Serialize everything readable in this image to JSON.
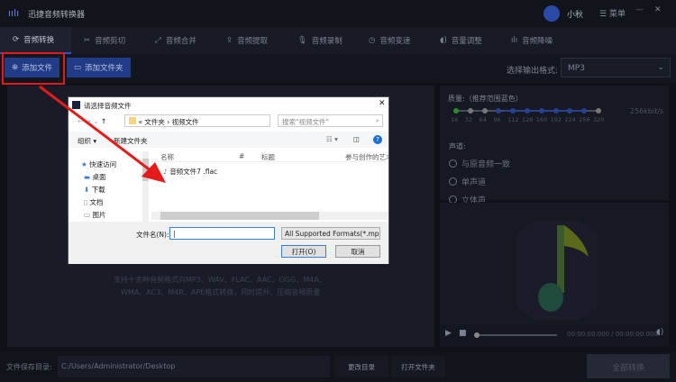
{
  "app": {
    "title": "迅捷音频转换器",
    "user": "小秋",
    "menu": "菜单"
  },
  "tabs": [
    {
      "label": "音频转换",
      "icon": "refresh-icon"
    },
    {
      "label": "音频剪切",
      "icon": "scissors-icon"
    },
    {
      "label": "音频合并",
      "icon": "merge-icon"
    },
    {
      "label": "音频提取",
      "icon": "extract-icon"
    },
    {
      "label": "音频录制",
      "icon": "mic-icon"
    },
    {
      "label": "音频变速",
      "icon": "speed-icon"
    },
    {
      "label": "音量调整",
      "icon": "volume-icon"
    },
    {
      "label": "音频降噪",
      "icon": "denoise-icon"
    }
  ],
  "toolbar": {
    "add_file": "添加文件",
    "add_folder": "添加文件夹",
    "format_label": "选择输出格式:",
    "format_value": "MP3"
  },
  "left": {
    "support_line1": "支持十余种音频格式向MP3、WAV、FLAC、AAC、OGG、M4A、",
    "support_line2": "WMA、AC3、M4R、APE格式转换，同时提升、压缩音频质量"
  },
  "settings": {
    "quality_label": "质量:（推荐范围蓝色）",
    "bitrates": [
      "16",
      "32",
      "64",
      "96",
      "112",
      "128",
      "160",
      "192",
      "224",
      "256",
      "320"
    ],
    "current_bitrate": "256kbit/s",
    "channel_label": "声道:",
    "channels": [
      "与原音频一致",
      "单声道",
      "立体声"
    ]
  },
  "player": {
    "time": "00:00:00.000 / 00:00:00.000",
    "progress": 0
  },
  "bottom": {
    "save_label": "文件保存目录:",
    "save_path": "C:/Users/Administrator/Desktop",
    "change_dir": "更改目录",
    "open_folder": "打开文件夹",
    "convert_all": "全部转换"
  },
  "dialog": {
    "title": "请选择音频文件",
    "crumb_root": "文件夹",
    "crumb_current": "视频文件",
    "search_placeholder": "搜索\"视频文件\"",
    "organize": "组织 ▾",
    "new_folder": "新建文件夹",
    "nav": [
      {
        "label": "快速访问"
      },
      {
        "label": "桌面"
      },
      {
        "label": "下载"
      },
      {
        "label": "文档"
      },
      {
        "label": "图片"
      }
    ],
    "columns": [
      "名称",
      "#",
      "标题",
      "参与创作的艺术"
    ],
    "files": [
      "音频文件7 .flac"
    ],
    "filename_label": "文件名(N):",
    "filename_value": "",
    "filter": "All Supported Formats(*.mp:",
    "open": "打开(O)",
    "cancel": "取消"
  },
  "colors": {
    "accent": "#213b86",
    "annotation": "#e51a1a"
  }
}
